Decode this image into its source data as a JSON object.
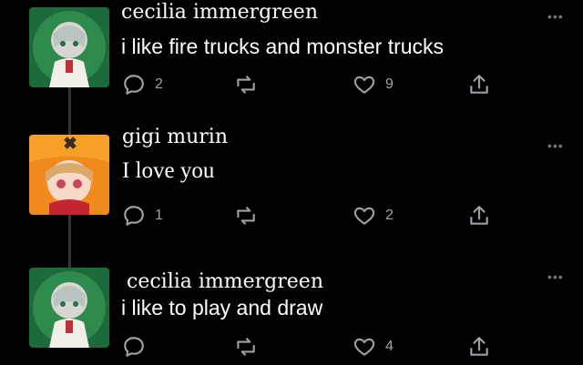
{
  "colors": {
    "background": "#000000",
    "text": "#ffffff",
    "icon": "#9aa0a6",
    "thread_line": "#333639"
  },
  "posts": [
    {
      "author": "cecilia immergreen",
      "text": "i like fire trucks and monster trucks",
      "replies": "2",
      "reposts": "",
      "likes": "9",
      "avatar_icon": "anime-avatar-green"
    },
    {
      "author": "gigi murin",
      "text": "I love you",
      "replies": "1",
      "reposts": "",
      "likes": "2",
      "avatar_icon": "anime-avatar-orange"
    },
    {
      "author": "cecilia immergreen",
      "text": "i like to play and draw",
      "replies": "",
      "reposts": "",
      "likes": "4",
      "avatar_icon": "anime-avatar-green"
    }
  ],
  "more_label": "•••"
}
